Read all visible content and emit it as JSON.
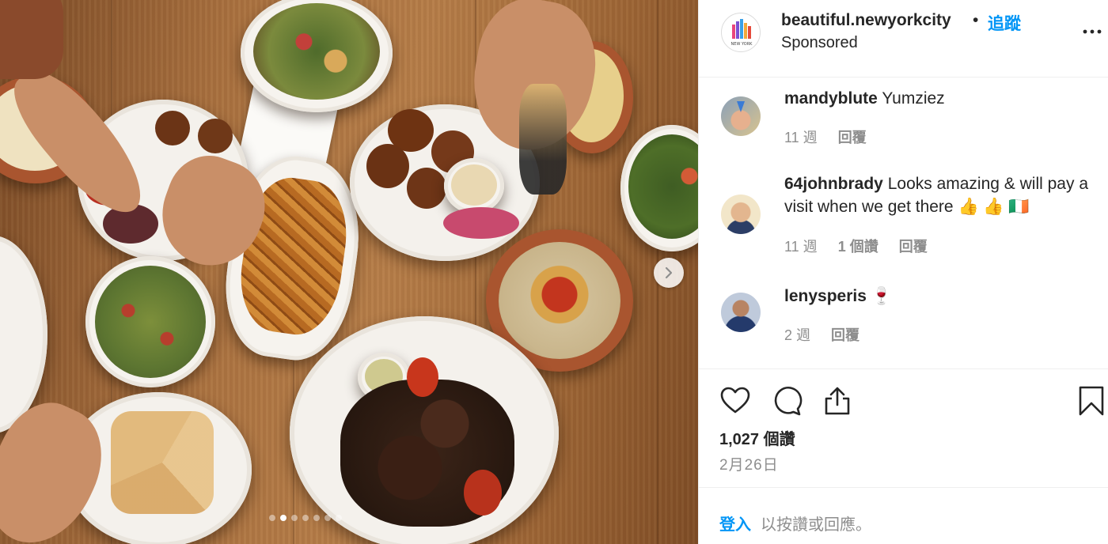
{
  "post": {
    "username": "beautiful.newyorkcity",
    "separator": "•",
    "follow_label": "追蹤",
    "sponsored_label": "Sponsored",
    "avatar_icon": "new-york-logo-icon",
    "avatar_text": "NEW YORK"
  },
  "media": {
    "description_icon": "food-photo",
    "carousel": {
      "total": 7,
      "current": 2
    },
    "next_icon": "chevron-right-icon"
  },
  "comments": [
    {
      "username": "mandyblute",
      "text": " Yumziez",
      "age": "11 週",
      "likes": "",
      "reply": "回覆"
    },
    {
      "username": "64johnbrady",
      "text": " Looks amazing & will pay a visit when we get there 👍 👍 🇮🇪",
      "age": "11 週",
      "likes": "1 個讚",
      "reply": "回覆"
    },
    {
      "username": "lenysperis",
      "text": " 🍷",
      "age": "2 週",
      "likes": "",
      "reply": "回覆"
    }
  ],
  "actions": {
    "like_icon": "heart-icon",
    "comment_icon": "comment-icon",
    "share_icon": "share-icon",
    "save_icon": "bookmark-icon",
    "likes_count": "1,027 個讚",
    "date": "2月26日"
  },
  "login": {
    "login_label": "登入",
    "rest_label": "以按讚或回應。"
  },
  "colors": {
    "accent": "#0095f6",
    "text": "#262626",
    "muted": "#8e8e8e",
    "border": "#efefef"
  }
}
